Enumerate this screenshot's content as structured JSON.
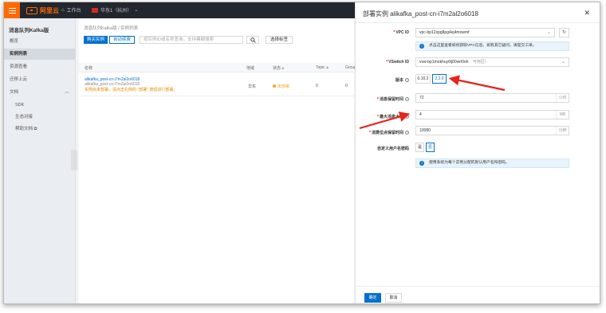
{
  "topbar": {
    "brand": "阿里云",
    "workbench": "工作台",
    "region": "华东1（杭州）"
  },
  "sidebar": {
    "title": "消息队列Kafka版",
    "items": [
      {
        "label": "概览"
      },
      {
        "label": "实例列表"
      },
      {
        "label": "资源查看"
      },
      {
        "label": "迁移上云"
      },
      {
        "label": "文档"
      },
      {
        "label": "SDK"
      },
      {
        "label": "生态对接"
      },
      {
        "label": "帮助文档"
      }
    ]
  },
  "main": {
    "breadcrumb": "消息队列Kafka版 / 实例列表",
    "buy_button": "购买实例",
    "overview_button": "自动续费",
    "search_placeholder": "按实例ID或名称查询，支持模糊搜索",
    "tag_button": "选择标签",
    "columns": [
      "名称",
      "地域",
      "状态",
      "Topic",
      "Group"
    ],
    "row": {
      "name": "alikafka_post-cn-i7m2al2o6018",
      "id": "alikafka_post-cn-i7m2al2o6018",
      "warning": "实例尚未部署，请点击右侧的 \"部署\" 按钮进行部署。",
      "region": "华东",
      "status": "未部署",
      "topic": "0",
      "group": "0"
    }
  },
  "drawer": {
    "title": "部署实例 alikafka_post-cn-i7m2al2o6018",
    "close": "✕",
    "vpc_label": "VPC ID",
    "vpc_value": "vpc-bp12xpg8pg4ej4mowmf",
    "vpc_info": "点击这里查看如何获取VPC信息。如有其它疑问，请提交工单。",
    "vswitch_label": "VSwitch ID",
    "vswitch_value": "vsw-bp1mokhuy6lj00wrl0oh",
    "vswitch_zone": "可用区I",
    "version_label": "版本",
    "versions": [
      "0.10.2",
      "2.2.0"
    ],
    "retention_label": "消息保留时间",
    "retention_value": "72",
    "retention_unit": "小时",
    "max_msg_label": "最大消息大小",
    "max_msg_value": "4",
    "max_msg_unit": "MB",
    "consumer_label": "消费位点保留时间",
    "consumer_value": "10080",
    "consumer_unit": "分钟",
    "custom_user_label": "自定义用户名密码",
    "custom_user_options": [
      "是",
      "否"
    ],
    "custom_user_info": "使用系统为每个实例分配的默认用户名和密码。",
    "ok_button": "确定",
    "cancel_button": "取消"
  }
}
